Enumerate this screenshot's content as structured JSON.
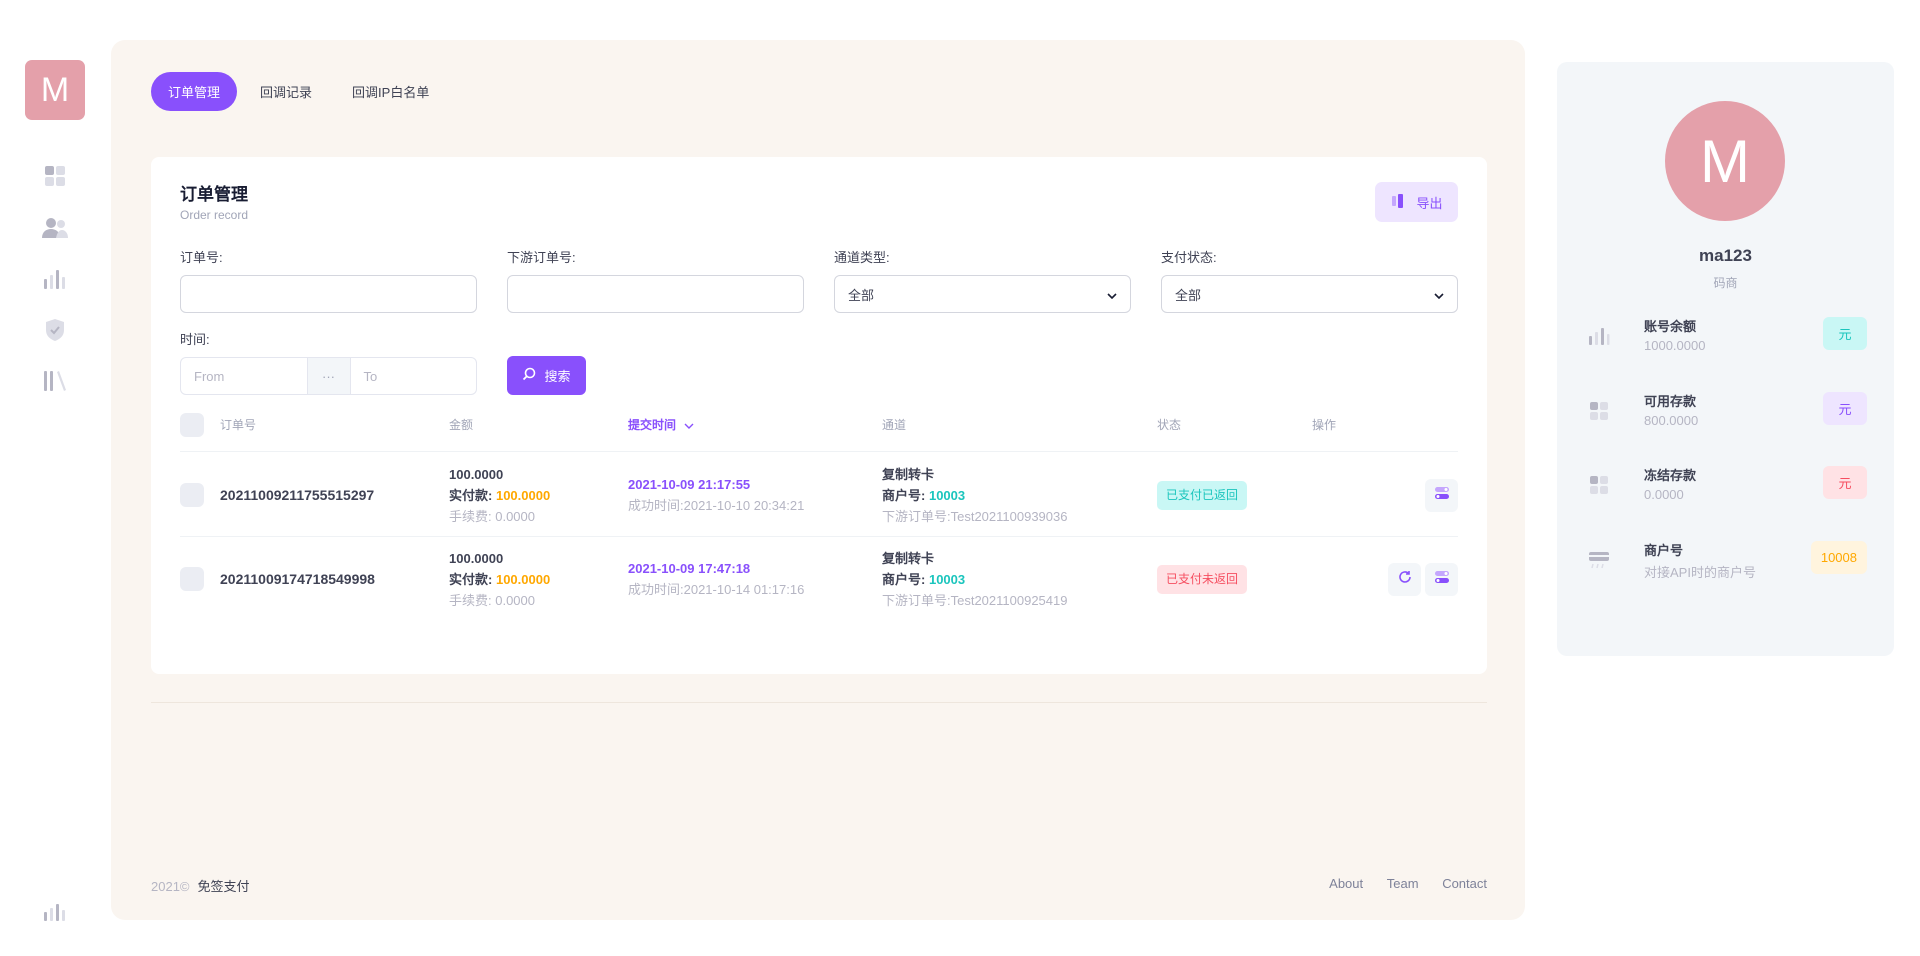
{
  "aside": {
    "logo_letter": "M",
    "nav_icons": [
      "grid-icon",
      "users-icon",
      "bar-chart-icon",
      "shield-icon",
      "library-icon"
    ],
    "bottom_icon": "bar-chart-icon"
  },
  "tabs": [
    {
      "label": "订单管理",
      "active": true
    },
    {
      "label": "回调记录",
      "active": false
    },
    {
      "label": "回调IP白名单",
      "active": false
    }
  ],
  "card": {
    "title": "订单管理",
    "subtitle": "Order record",
    "export_label": "导出"
  },
  "filters": {
    "order_no_label": "订单号:",
    "downstream_no_label": "下游订单号:",
    "channel_label": "通道类型:",
    "channel_value": "全部",
    "pay_status_label": "支付状态:",
    "pay_status_value": "全部",
    "time_label": "时间:",
    "from_placeholder": "From",
    "to_placeholder": "To",
    "date_sep": "···",
    "search_label": "搜索"
  },
  "table": {
    "headers": {
      "order_no": "订单号",
      "amount": "金额",
      "submit_time": "提交时间",
      "channel": "通道",
      "status": "状态",
      "action": "操作"
    },
    "rows": [
      {
        "order_no": "20211009211755515297",
        "amount": "100.0000",
        "paid_label": "实付款:",
        "paid": "100.0000",
        "fee": "手续费: 0.0000",
        "submit_time": "2021-10-09 21:17:55",
        "success_time": "成功时间:2021-10-10 20:34:21",
        "channel": "复制转卡",
        "merchant_label": "商户号:",
        "merchant": "10003",
        "downstream": "下游订单号:Test2021100939036",
        "status": "已支付已返回",
        "status_type": "ok"
      },
      {
        "order_no": "20211009174718549998",
        "amount": "100.0000",
        "paid_label": "实付款:",
        "paid": "100.0000",
        "fee": "手续费: 0.0000",
        "submit_time": "2021-10-09 17:47:18",
        "success_time": "成功时间:2021-10-14 01:17:16",
        "channel": "复制转卡",
        "merchant_label": "商户号:",
        "merchant": "10003",
        "downstream": "下游订单号:Test2021100925419",
        "status": "已支付未返回",
        "status_type": "bad"
      }
    ]
  },
  "footer": {
    "year": "2021©",
    "brand": "免签支付",
    "links": [
      "About",
      "Team",
      "Contact"
    ]
  },
  "profile": {
    "avatar_letter": "M",
    "name": "ma123",
    "role": "码商",
    "stats": [
      {
        "label": "账号余额",
        "value": "1000.0000",
        "tag": "元",
        "icon": "bar-chart-icon",
        "tag_bg": "#c9f7f5",
        "tag_color": "#1bc5bd"
      },
      {
        "label": "可用存款",
        "value": "800.0000",
        "tag": "元",
        "icon": "grid-icon",
        "tag_bg": "#eee5ff",
        "tag_color": "#8950fc"
      },
      {
        "label": "冻结存款",
        "value": "0.0000",
        "tag": "元",
        "icon": "grid-icon",
        "tag_bg": "#ffe2e5",
        "tag_color": "#f64e60"
      },
      {
        "label": "商户号",
        "value": "对接API时的商户号",
        "tag": "10008",
        "icon": "card-icon",
        "tag_bg": "#fff4de",
        "tag_color": "#ffa800"
      }
    ]
  },
  "colors": {
    "primary": "#8950fc",
    "main_bg": "#faf5f0",
    "avatar": "#e4a0aa",
    "success": "#1bc5bd",
    "danger": "#f64e60",
    "warning": "#ffa800"
  }
}
